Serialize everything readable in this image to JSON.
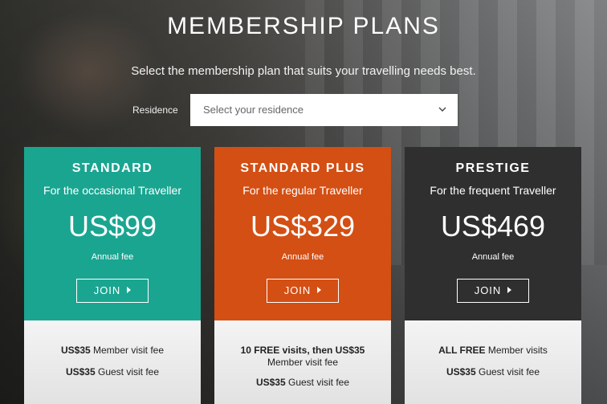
{
  "page": {
    "title": "MEMBERSHIP PLANS",
    "subtitle": "Select the membership plan that suits your travelling needs best."
  },
  "residence": {
    "label": "Residence",
    "placeholder": "Select your residence",
    "icon": "chevron-down-icon"
  },
  "plans": [
    {
      "name": "STANDARD",
      "tagline": "For the occasional Traveller",
      "price": "US$99",
      "fee_label": "Annual fee",
      "join_label": "JOIN",
      "color": "#1aa591",
      "features": [
        {
          "bold": "US$35",
          "text": " Member visit fee"
        },
        {
          "bold": "US$35",
          "text": " Guest visit fee"
        }
      ]
    },
    {
      "name": "STANDARD PLUS",
      "tagline": "For the regular Traveller",
      "price": "US$329",
      "fee_label": "Annual fee",
      "join_label": "JOIN",
      "color": "#d34f14",
      "features": [
        {
          "bold": "10 FREE visits, then US$35",
          "text": "Member visit fee"
        },
        {
          "bold": "US$35",
          "text": " Guest visit fee"
        }
      ]
    },
    {
      "name": "PRESTIGE",
      "tagline": "For the frequent Traveller",
      "price": "US$469",
      "fee_label": "Annual fee",
      "join_label": "JOIN",
      "color": "#2f2f2f",
      "features": [
        {
          "bold": "ALL FREE",
          "text": " Member visits"
        },
        {
          "bold": "US$35",
          "text": " Guest visit fee"
        }
      ]
    }
  ]
}
